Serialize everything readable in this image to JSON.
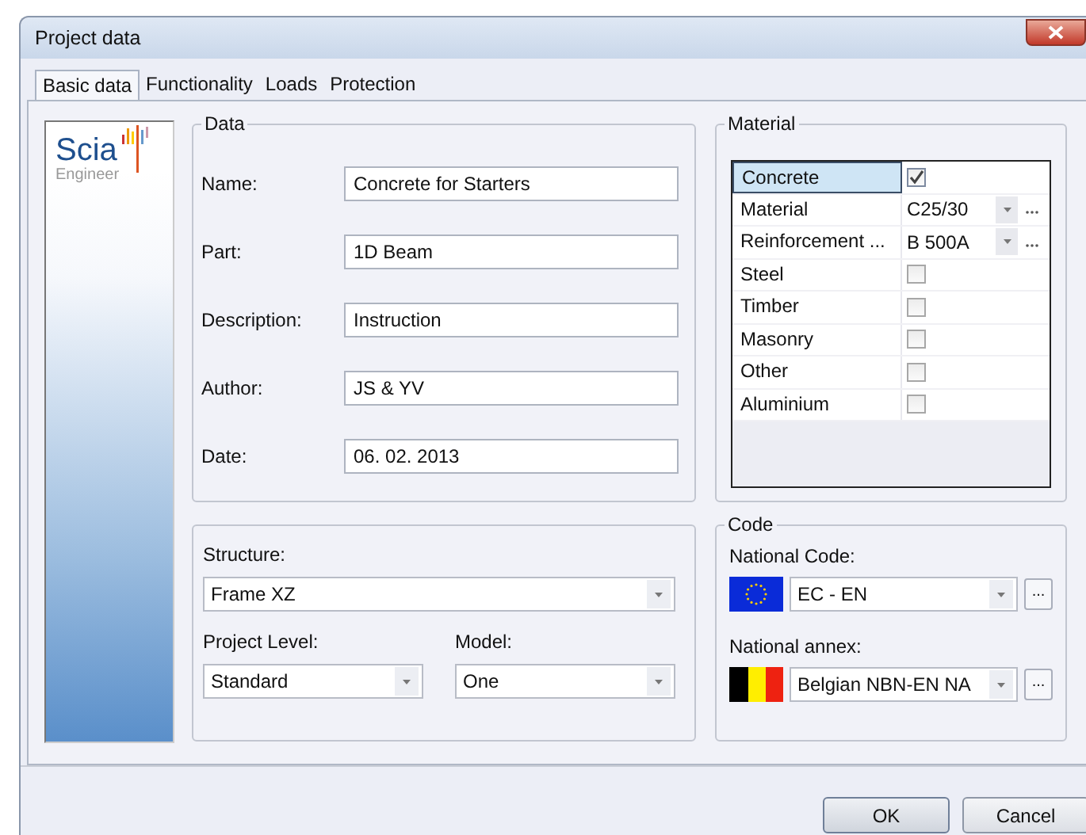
{
  "window": {
    "title": "Project data"
  },
  "tabs": [
    {
      "label": "Basic data",
      "selected": true
    },
    {
      "label": "Functionality",
      "selected": false
    },
    {
      "label": "Loads",
      "selected": false
    },
    {
      "label": "Protection",
      "selected": false
    }
  ],
  "logo": {
    "name": "Scia",
    "subtitle": "Engineer"
  },
  "data": {
    "title": "Data",
    "fields": [
      {
        "label": "Name:",
        "value": "Concrete for Starters"
      },
      {
        "label": "Part:",
        "value": "1D Beam"
      },
      {
        "label": "Description:",
        "value": "Instruction"
      },
      {
        "label": "Author:",
        "value": "JS & YV"
      },
      {
        "label": "Date:",
        "value": "06. 02. 2013"
      }
    ]
  },
  "structure": {
    "label": "Structure:",
    "value": "Frame XZ",
    "project_level": {
      "label": "Project Level:",
      "value": "Standard"
    },
    "model": {
      "label": "Model:",
      "value": "One"
    }
  },
  "material": {
    "title": "Material",
    "rows": [
      {
        "kind": "checkbox",
        "label": "Concrete",
        "checked": true,
        "selected": true
      },
      {
        "kind": "select",
        "label": "Material",
        "value": "C25/30",
        "selected": false
      },
      {
        "kind": "select",
        "label": "Reinforcement ...",
        "value": "B 500A",
        "selected": false
      },
      {
        "kind": "checkbox",
        "label": "Steel",
        "checked": false,
        "selected": false
      },
      {
        "kind": "checkbox",
        "label": "Timber",
        "checked": false,
        "selected": false
      },
      {
        "kind": "checkbox",
        "label": "Masonry",
        "checked": false,
        "selected": false
      },
      {
        "kind": "checkbox",
        "label": "Other",
        "checked": false,
        "selected": false
      },
      {
        "kind": "checkbox",
        "label": "Aluminium",
        "checked": false,
        "selected": false
      }
    ]
  },
  "code": {
    "title": "Code",
    "selectors": [
      {
        "kind": "eu",
        "label": "National Code:",
        "value": "EC - EN",
        "more": "..."
      },
      {
        "kind": "be",
        "label": "National annex:",
        "value": "Belgian NBN-EN NA",
        "more": "..."
      }
    ]
  },
  "buttons": [
    {
      "label": "OK",
      "kind": "default"
    },
    {
      "label": "Cancel",
      "kind": "normal"
    }
  ]
}
